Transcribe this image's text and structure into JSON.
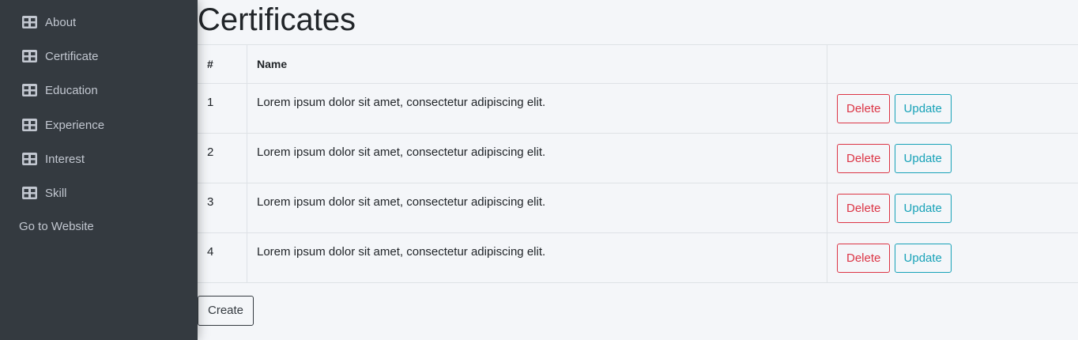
{
  "sidebar": {
    "items": [
      {
        "label": "About",
        "icon": "table-icon"
      },
      {
        "label": "Certificate",
        "icon": "table-icon"
      },
      {
        "label": "Education",
        "icon": "table-icon"
      },
      {
        "label": "Experience",
        "icon": "table-icon"
      },
      {
        "label": "Interest",
        "icon": "table-icon"
      },
      {
        "label": "Skill",
        "icon": "table-icon"
      }
    ],
    "goto_website": "Go to Website"
  },
  "page": {
    "title": "Certificates"
  },
  "table": {
    "headers": {
      "num": "#",
      "name": "Name",
      "actions": ""
    },
    "rows": [
      {
        "num": "1",
        "name": "Lorem ipsum dolor sit amet, consectetur adipiscing elit.",
        "delete": "Delete",
        "update": "Update"
      },
      {
        "num": "2",
        "name": "Lorem ipsum dolor sit amet, consectetur adipiscing elit.",
        "delete": "Delete",
        "update": "Update"
      },
      {
        "num": "3",
        "name": "Lorem ipsum dolor sit amet, consectetur adipiscing elit.",
        "delete": "Delete",
        "update": "Update"
      },
      {
        "num": "4",
        "name": "Lorem ipsum dolor sit amet, consectetur adipiscing elit.",
        "delete": "Delete",
        "update": "Update"
      }
    ]
  },
  "actions": {
    "create_label": "Create"
  },
  "colors": {
    "sidebar_bg": "#343a40",
    "sidebar_text": "#c2c7d0",
    "danger": "#dc3545",
    "info": "#17a2b8",
    "dark": "#343a40",
    "page_bg": "#f4f6f9"
  }
}
